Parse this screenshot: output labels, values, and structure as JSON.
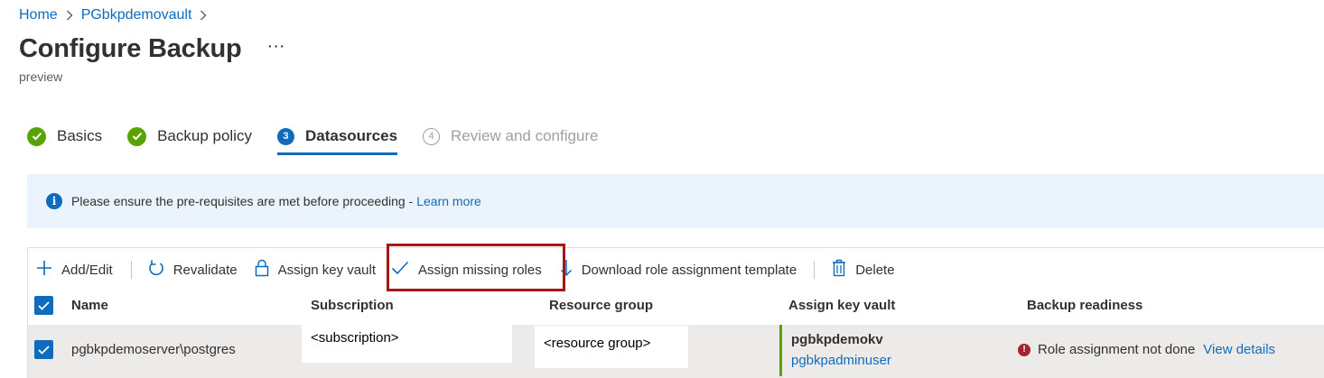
{
  "breadcrumb": {
    "home": "Home",
    "vault": "PGbkpdemovault"
  },
  "page": {
    "title": "Configure Backup",
    "more": "···",
    "subtitle": "preview"
  },
  "steps": [
    {
      "label": "Basics",
      "state": "completed"
    },
    {
      "label": "Backup policy",
      "state": "completed"
    },
    {
      "label": "Datasources",
      "number": "3",
      "state": "active"
    },
    {
      "label": "Review and configure",
      "number": "4",
      "state": "disabled"
    }
  ],
  "info": {
    "message": "Please ensure the pre-requisites are met before proceeding -",
    "link": "Learn more"
  },
  "toolbar": {
    "add_edit": "Add/Edit",
    "revalidate": "Revalidate",
    "assign_key_vault": "Assign key vault",
    "assign_missing_roles": "Assign missing roles",
    "download_template": "Download role assignment template",
    "delete": "Delete"
  },
  "table": {
    "columns": [
      "Name",
      "Subscription",
      "Resource group",
      "Assign key vault",
      "Backup readiness"
    ],
    "rows": [
      {
        "name": "pgbkpdemoserver\\postgres",
        "subscription": "<subscription>",
        "resource_group": "<resource group>",
        "key_vault": "pgbkpdemokv",
        "key_vault_user": "pgbkpadminuser",
        "readiness": "Role assignment not done",
        "readiness_link": "View details"
      }
    ]
  },
  "colors": {
    "accent": "#0f6cbd",
    "success": "#57a300",
    "error": "#a4262c",
    "highlight": "#a4161a",
    "info_bg": "#ebf3fc"
  }
}
